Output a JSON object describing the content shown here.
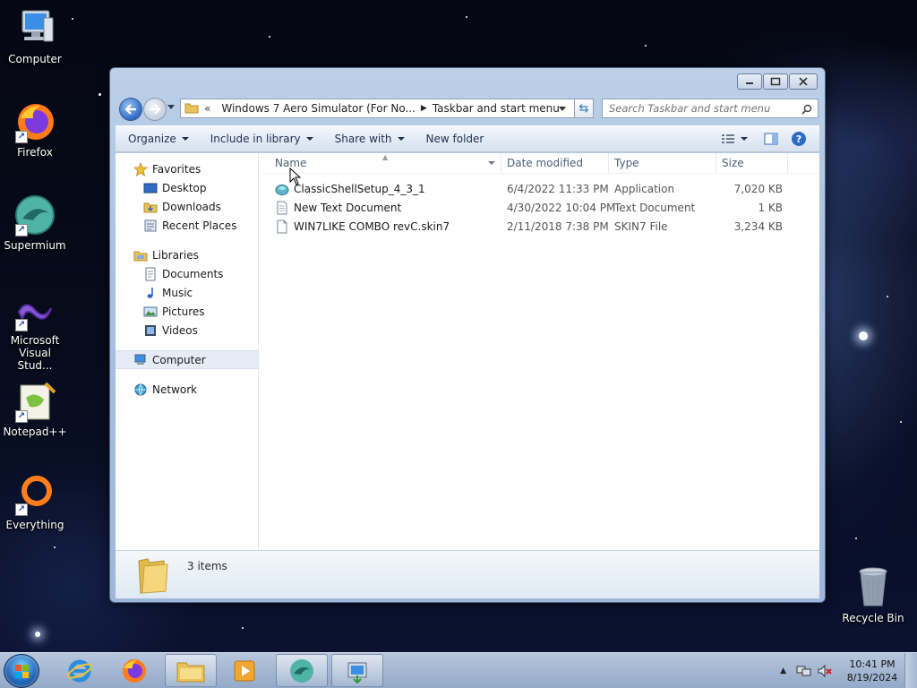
{
  "desktop": {
    "icons": [
      {
        "label": "Computer",
        "icon": "computer-icon"
      },
      {
        "label": "Firefox",
        "icon": "firefox-icon"
      },
      {
        "label": "Supermium",
        "icon": "supermium-icon"
      },
      {
        "label_line1": "Microsoft",
        "label_line2": "Visual Stud...",
        "icon": "visual-studio-icon"
      },
      {
        "label": "Notepad++",
        "icon": "notepad-plus-plus-icon"
      },
      {
        "label": "Everything",
        "icon": "everything-icon"
      },
      {
        "label": "Recycle Bin",
        "icon": "recycle-bin-icon"
      }
    ]
  },
  "window": {
    "address": {
      "overflow": "«",
      "segments": [
        "Windows 7 Aero Simulator (For No...",
        "Taskbar and start menu"
      ]
    },
    "search_placeholder": "Search Taskbar and start menu",
    "toolbar": {
      "organize": "Organize",
      "include_in_library": "Include in library",
      "share_with": "Share with",
      "new_folder": "New folder"
    },
    "nav": {
      "favorites": {
        "label": "Favorites",
        "items": [
          "Desktop",
          "Downloads",
          "Recent Places"
        ]
      },
      "libraries": {
        "label": "Libraries",
        "items": [
          "Documents",
          "Music",
          "Pictures",
          "Videos"
        ]
      },
      "computer": "Computer",
      "network": "Network"
    },
    "columns": {
      "name": "Name",
      "date": "Date modified",
      "type": "Type",
      "size": "Size"
    },
    "files": [
      {
        "name": "ClassicShellSetup_4_3_1",
        "date": "6/4/2022 11:33 PM",
        "type": "Application",
        "size": "7,020 KB",
        "icon": "application-icon"
      },
      {
        "name": "New Text Document",
        "date": "4/30/2022 10:04 PM",
        "type": "Text Document",
        "size": "1 KB",
        "icon": "text-document-icon"
      },
      {
        "name": "WIN7LIKE COMBO revC.skin7",
        "date": "2/11/2018 7:38 PM",
        "type": "SKIN7 File",
        "size": "3,234 KB",
        "icon": "file-icon"
      }
    ],
    "status": {
      "count": "3 items"
    }
  },
  "taskbar": {
    "clock": {
      "time": "10:41 PM",
      "date": "8/19/2024"
    },
    "apps": [
      "internet-explorer-icon",
      "firefox-icon",
      "file-explorer-icon",
      "media-player-icon",
      "supermium-icon",
      "installer-icon"
    ]
  },
  "colors": {
    "accent": "#2f6bc5",
    "selection": "#e5ecf6"
  }
}
